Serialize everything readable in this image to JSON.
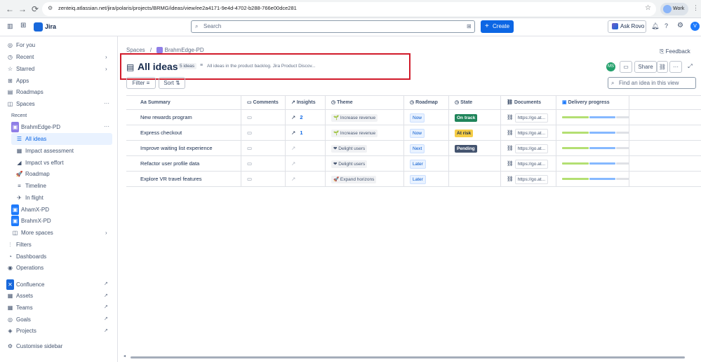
{
  "browser": {
    "url": "zenteiq.atlassian.net/jira/polaris/projects/BRMG/ideas/view/ee2a4171-9e4d-4702-b288-766e00dce281",
    "profile_label": "Work",
    "avatar_letter": "V"
  },
  "topbar": {
    "product": "Jira",
    "search_placeholder": "Search",
    "create_label": "Create",
    "ask_rovo_label": "Ask Rovo",
    "avatar_letter": "V"
  },
  "sidebar": {
    "for_you": "For you",
    "recent": "Recent",
    "starred": "Starred",
    "apps": "Apps",
    "roadmaps": "Roadmaps",
    "spaces": "Spaces",
    "recent_header": "Recent",
    "project": "BrahmEdge-PD",
    "views": [
      "All ideas",
      "Impact assessment",
      "Impact vs effort",
      "Roadmap",
      "Timeline",
      "In flight"
    ],
    "other_projects": [
      "AhamX-PD",
      "BrahmX-PD"
    ],
    "more_spaces": "More spaces",
    "filters": "Filters",
    "dashboards": "Dashboards",
    "operations": "Operations",
    "apps_list": [
      "Confluence",
      "Assets",
      "Teams",
      "Goals",
      "Projects"
    ],
    "customise": "Customise sidebar"
  },
  "main": {
    "breadcrumb_root": "Spaces",
    "breadcrumb_sep": "/",
    "breadcrumb_project": "BrahmEdge-PD",
    "title": "All ideas",
    "count": "5 ideas",
    "description": "All ideas in the product backlog. Jira Product Discov...",
    "feedback": "Feedback",
    "avatar_initials": "MS",
    "share_label": "Share",
    "filter_label": "Filter",
    "sort_label": "Sort",
    "find_placeholder": "Find an idea in this view"
  },
  "table": {
    "columns": [
      "Summary",
      "Comments",
      "Insights",
      "Theme",
      "Roadmap",
      "State",
      "Documents",
      "Delivery progress"
    ],
    "rows": [
      {
        "summary": "New rewards program",
        "insights": "2",
        "theme": "Increase revenue",
        "theme_icon": "🌱",
        "roadmap": "Now",
        "state": "On track",
        "state_color": "#1f845a",
        "state_text_color": "#ffffff",
        "document": "https://go.at...",
        "progress": [
          0.4,
          0.4
        ]
      },
      {
        "summary": "Express checkout",
        "insights": "1",
        "theme": "Increase revenue",
        "theme_icon": "🌱",
        "roadmap": "Now",
        "state": "At risk",
        "state_color": "#f5cd47",
        "state_text_color": "#172b4d",
        "document": "https://go.at...",
        "progress": [
          0.4,
          0.4
        ]
      },
      {
        "summary": "Improve waiting list experience",
        "insights": "",
        "theme": "Delight users",
        "theme_icon": "❤",
        "roadmap": "Next",
        "state": "Pending",
        "state_color": "#44546f",
        "state_text_color": "#ffffff",
        "document": "https://go.at...",
        "progress": [
          0.4,
          0.4
        ]
      },
      {
        "summary": "Refactor user profile data",
        "insights": "",
        "theme": "Delight users",
        "theme_icon": "❤",
        "roadmap": "Later",
        "state": "",
        "state_color": "",
        "state_text_color": "",
        "document": "https://go.at...",
        "progress": [
          0.4,
          0.4
        ]
      },
      {
        "summary": "Explore VR travel features",
        "insights": "",
        "theme": "Expand horizons",
        "theme_icon": "🚀",
        "roadmap": "Later",
        "state": "",
        "state_color": "",
        "state_text_color": "",
        "document": "https://go.at...",
        "progress": [
          0.4,
          0.4
        ]
      }
    ]
  }
}
